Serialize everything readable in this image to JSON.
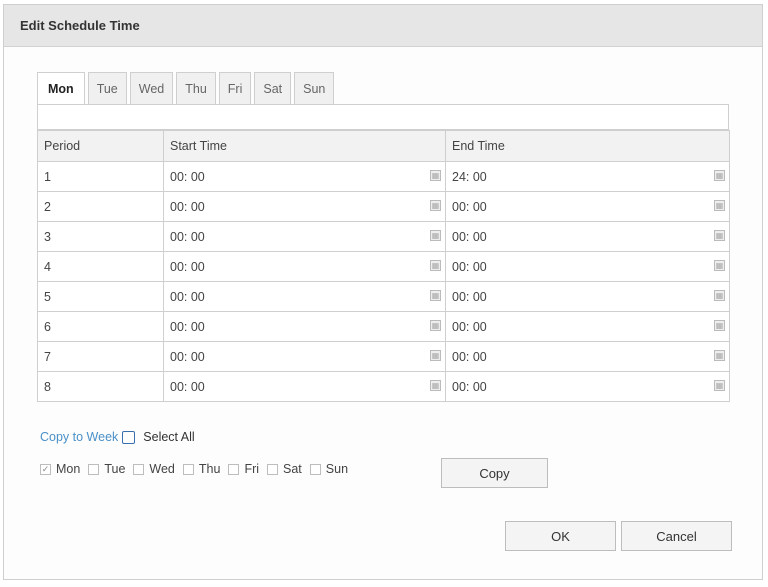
{
  "dialog": {
    "title": "Edit Schedule Time"
  },
  "tabs": [
    {
      "label": "Mon",
      "active": true
    },
    {
      "label": "Tue"
    },
    {
      "label": "Wed"
    },
    {
      "label": "Thu"
    },
    {
      "label": "Fri"
    },
    {
      "label": "Sat"
    },
    {
      "label": "Sun"
    }
  ],
  "table": {
    "headers": {
      "period": "Period",
      "start": "Start Time",
      "end": "End Time"
    },
    "rows": [
      {
        "period": "1",
        "start": "00: 00",
        "end": "24: 00"
      },
      {
        "period": "2",
        "start": "00: 00",
        "end": "00: 00"
      },
      {
        "period": "3",
        "start": "00: 00",
        "end": "00: 00"
      },
      {
        "period": "4",
        "start": "00: 00",
        "end": "00: 00"
      },
      {
        "period": "5",
        "start": "00: 00",
        "end": "00: 00"
      },
      {
        "period": "6",
        "start": "00: 00",
        "end": "00: 00"
      },
      {
        "period": "7",
        "start": "00: 00",
        "end": "00: 00"
      },
      {
        "period": "8",
        "start": "00: 00",
        "end": "00: 00"
      }
    ],
    "time_picker_icon": "calendar-icon"
  },
  "copy": {
    "link_label": "Copy to Week",
    "select_all_label": "Select All",
    "days": [
      {
        "label": "Mon",
        "checked": true
      },
      {
        "label": "Tue",
        "checked": false
      },
      {
        "label": "Wed",
        "checked": false
      },
      {
        "label": "Thu",
        "checked": false
      },
      {
        "label": "Fri",
        "checked": false
      },
      {
        "label": "Sat",
        "checked": false
      },
      {
        "label": "Sun",
        "checked": false
      }
    ],
    "copy_button": "Copy"
  },
  "footer": {
    "ok": "OK",
    "cancel": "Cancel"
  },
  "colors": {
    "link": "#4a90c8",
    "select_all_border": "#3a6fb0",
    "titlebar": "#e6e6e6"
  }
}
